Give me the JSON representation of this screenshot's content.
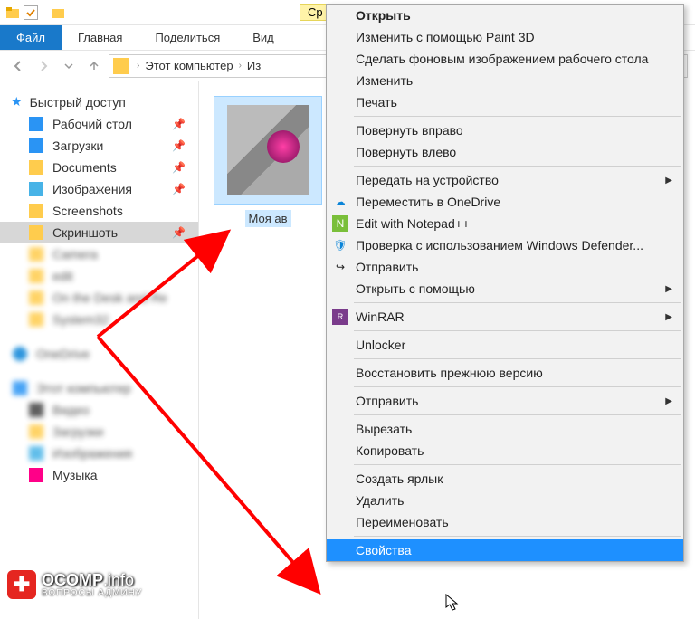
{
  "tabs": {
    "file": "Файл",
    "home": "Главная",
    "share": "Поделиться",
    "view": "Вид"
  },
  "breadcrumb": {
    "root": "Этот компьютер",
    "leaf": "Из"
  },
  "sidebar": {
    "quick_access": "Быстрый доступ",
    "items": [
      {
        "label": "Рабочий стол",
        "pinned": true
      },
      {
        "label": "Загрузки",
        "pinned": true
      },
      {
        "label": "Documents",
        "pinned": true
      },
      {
        "label": "Изображения",
        "pinned": true
      },
      {
        "label": "Screenshots",
        "pinned": false
      },
      {
        "label": "Скриншоть",
        "pinned": true,
        "selected": true
      }
    ],
    "music": "Музыка"
  },
  "file": {
    "name": "Моя ав"
  },
  "context_menu": {
    "open": "Открыть",
    "paint3d": "Изменить с помощью Paint 3D",
    "wallpaper": "Сделать фоновым изображением рабочего стола",
    "edit": "Изменить",
    "print": "Печать",
    "rotate_right": "Повернуть вправо",
    "rotate_left": "Повернуть влево",
    "cast": "Передать на устройство",
    "onedrive": "Переместить в OneDrive",
    "notepadpp": "Edit with Notepad++",
    "defender": "Проверка с использованием Windows Defender...",
    "share": "Отправить",
    "open_with": "Открыть с помощью",
    "winrar": "WinRAR",
    "unlocker": "Unlocker",
    "restore": "Восстановить прежнюю версию",
    "send_to": "Отправить",
    "cut": "Вырезать",
    "copy": "Копировать",
    "shortcut": "Создать ярлык",
    "delete": "Удалить",
    "rename": "Переименовать",
    "properties": "Свойства"
  },
  "ribbon_highlight": "Ср",
  "watermark": {
    "site": "OCOMP",
    "tld": ".info",
    "sub": "ВОПРОСЫ АДМИНУ"
  }
}
